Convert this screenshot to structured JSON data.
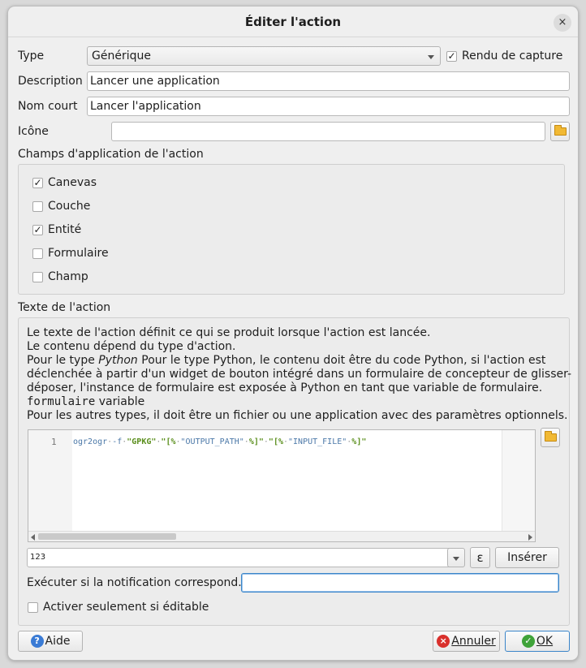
{
  "window": {
    "title": "Éditer l'action",
    "close_icon": "×"
  },
  "form": {
    "type_label": "Type",
    "type_value": "Générique",
    "capture_label": "Rendu de capture",
    "capture_checked": true,
    "description_label": "Description",
    "description_value": "Lancer une application",
    "short_name_label": "Nom court",
    "short_name_value": "Lancer l'application",
    "icon_label": "Icône",
    "icon_value": ""
  },
  "scopes": {
    "title": "Champs d'application de l'action",
    "items": [
      {
        "label": "Canevas",
        "checked": true
      },
      {
        "label": "Couche",
        "checked": false
      },
      {
        "label": "Entité",
        "checked": true
      },
      {
        "label": "Formulaire",
        "checked": false
      },
      {
        "label": "Champ",
        "checked": false
      }
    ]
  },
  "action_text": {
    "title": "Texte de l'action",
    "line1": "Le texte de l'action définit ce qui se produit lorsque l'action est lancée.",
    "line2": "Le contenu dépend du type d'action.",
    "line3_prefix": "Pour le type ",
    "line3_python": "Python",
    "line3_rest": " Pour le type Python, le contenu doit être du code Python, si l'action est",
    "line4": "déclenchée à partir d'un widget de bouton intégré dans un formulaire de concepteur de glisser-",
    "line5": "déposer, l'instance de formulaire est exposée à Python en tant que variable de formulaire.",
    "line6_code": "formulaire",
    "line6_rest": " variable",
    "line7": "Pour les autres types, il doit être un fichier ou une application avec des paramètres optionnels.",
    "editor": {
      "line_number": "1",
      "code_cmd": "ogr2ogr",
      "code_flag": "-f",
      "code_format": "\"GPKG\"",
      "code_output": "\"[%",
      "code_output_var": "\"OUTPUT_PATH\"",
      "code_output_end": "%]\"",
      "code_input": "\"[%",
      "code_input_var": "\"INPUT_FILE\"",
      "code_input_end": "%]\""
    },
    "expression_combo_value": "123",
    "epsilon_label": "ε",
    "insert_button": "Insérer",
    "notification_label": "Exécuter si la notification correspond.",
    "notification_value": "",
    "editable_only_label": "Activer seulement si éditable",
    "editable_only_checked": false
  },
  "footer": {
    "help_label": "Aide",
    "help_icon": "?",
    "cancel_label": "Annuler",
    "cancel_icon": "×",
    "ok_label": "OK",
    "ok_icon": "✓"
  },
  "colors": {
    "help_icon": "#3a7bd5",
    "cancel_icon": "#d9302c",
    "ok_icon": "#3fa339",
    "folder": "#f1b934"
  }
}
